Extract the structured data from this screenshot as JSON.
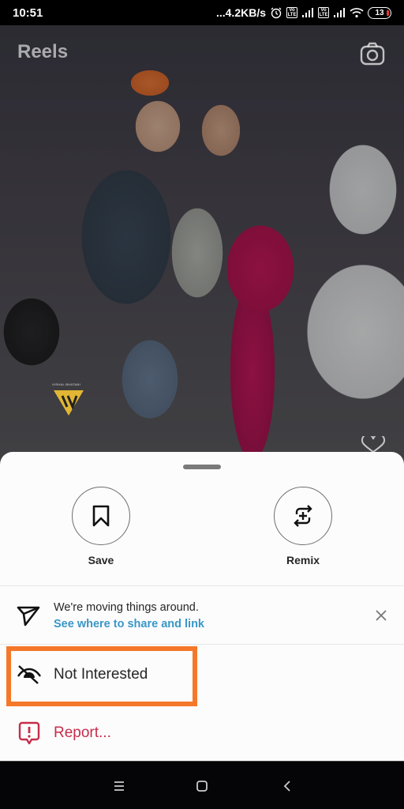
{
  "status_bar": {
    "time": "10:51",
    "network_speed": "...4.2KB/s",
    "volte_label": "Vo LTE",
    "battery_level": "13",
    "icons": [
      "alarm-icon",
      "volte-icon",
      "signal-icon",
      "volte-icon",
      "signal-icon",
      "wifi-icon",
      "battery-icon"
    ]
  },
  "header": {
    "title": "Reels",
    "camera_icon": "camera-icon"
  },
  "video": {
    "watermark_text": "VISHAL BHATANI",
    "like_icon": "heart-icon"
  },
  "sheet": {
    "actions": [
      {
        "label": "Save",
        "icon": "bookmark-icon"
      },
      {
        "label": "Remix",
        "icon": "remix-icon"
      }
    ],
    "notice": {
      "title": "We're moving things around.",
      "link": "See where to share and link",
      "icon": "send-icon",
      "dismiss_icon": "close-icon"
    },
    "menu": [
      {
        "label": "Not Interested",
        "icon": "eye-off-icon",
        "highlighted": true
      },
      {
        "label": "Report...",
        "icon": "report-icon"
      }
    ]
  },
  "colors": {
    "highlight": "#f5782a",
    "link": "#3897c7",
    "report": "#c62d4a"
  },
  "nav_bar": {
    "buttons": [
      "menu-icon",
      "home-icon",
      "back-icon"
    ]
  }
}
